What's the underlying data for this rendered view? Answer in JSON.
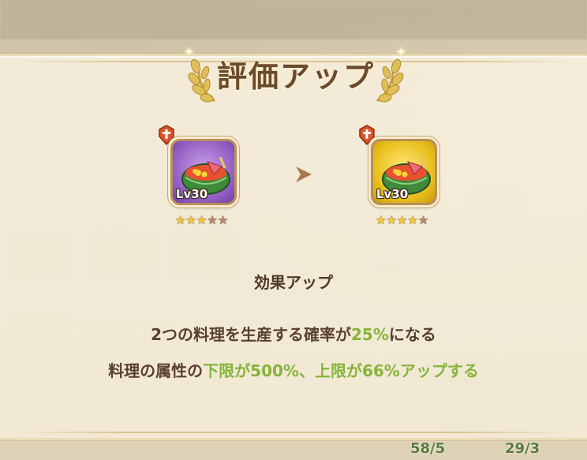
{
  "popup": {
    "title": "評価アップ",
    "before_item": {
      "level": "Lv30",
      "stars_filled": 3,
      "stars_total": 5,
      "frame_color": "#8f5cc1"
    },
    "after_item": {
      "level": "Lv30",
      "stars_filled": 4,
      "stars_total": 5,
      "frame_color": "#e9bf1c"
    },
    "effect_heading": "効果アップ",
    "effect_line1": {
      "prefix": "2つの料理を生産する確率が",
      "highlight": "25%",
      "suffix": "になる"
    },
    "effect_line2": {
      "prefix": "料理の属性の",
      "highlight1": "下限が500%、",
      "middle": "上限が66%",
      "highlight_suffix": "アップする"
    }
  },
  "background": {
    "counter_left": "58/5",
    "counter_right": "29/3"
  },
  "colors": {
    "highlight_green": "#86b43a",
    "text_brown": "#5a4030",
    "title_brown": "#6b4a2b"
  }
}
